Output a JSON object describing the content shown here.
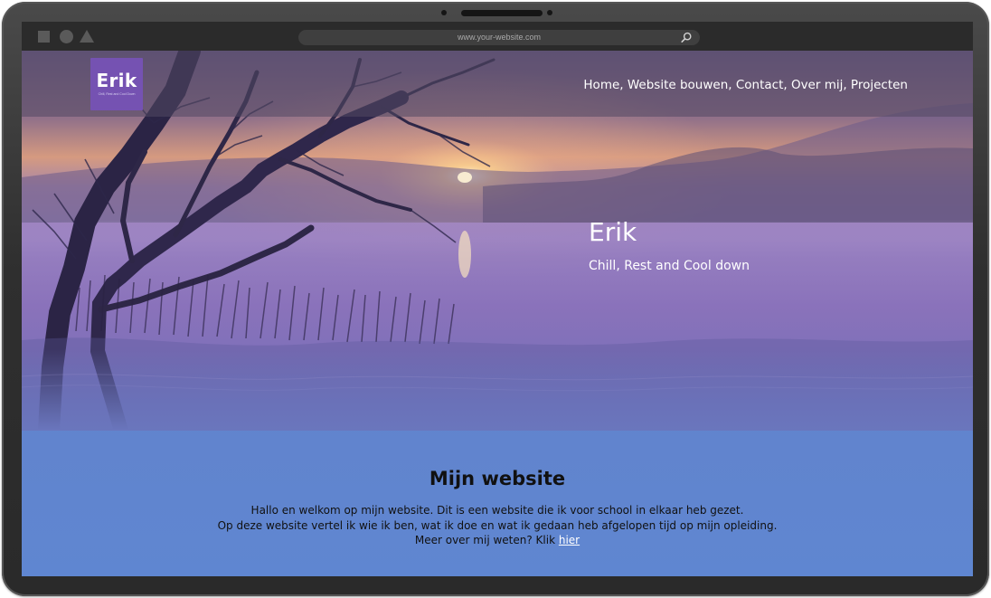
{
  "browser": {
    "address": "www.your-website.com",
    "search_icon": "search-icon"
  },
  "site": {
    "logo": {
      "name": "Erik",
      "tagline": "Chill, Rest and Cool Down"
    },
    "nav_text": "Home, Website bouwen, Contact, Over mij, Projecten",
    "hero": {
      "title": "Erik",
      "subtitle": "Chill, Rest and Cool down"
    },
    "content": {
      "title": "Mijn website",
      "line1": "Hallo en welkom op mijn website. Dit is een website die ik voor school in elkaar heb gezet.",
      "line2": "Op deze website vertel ik wie ik ben, wat ik doe en wat ik gedaan heb afgelopen tijd op mijn opleiding.",
      "line3_prefix": "Meer over mij weten? Klik ",
      "line3_link": "hier"
    }
  },
  "colors": {
    "logo_bg": "#7552b2",
    "page_bg": "#6482c9",
    "header_overlay": "#524862",
    "device_frame": "#3a3a3a"
  }
}
